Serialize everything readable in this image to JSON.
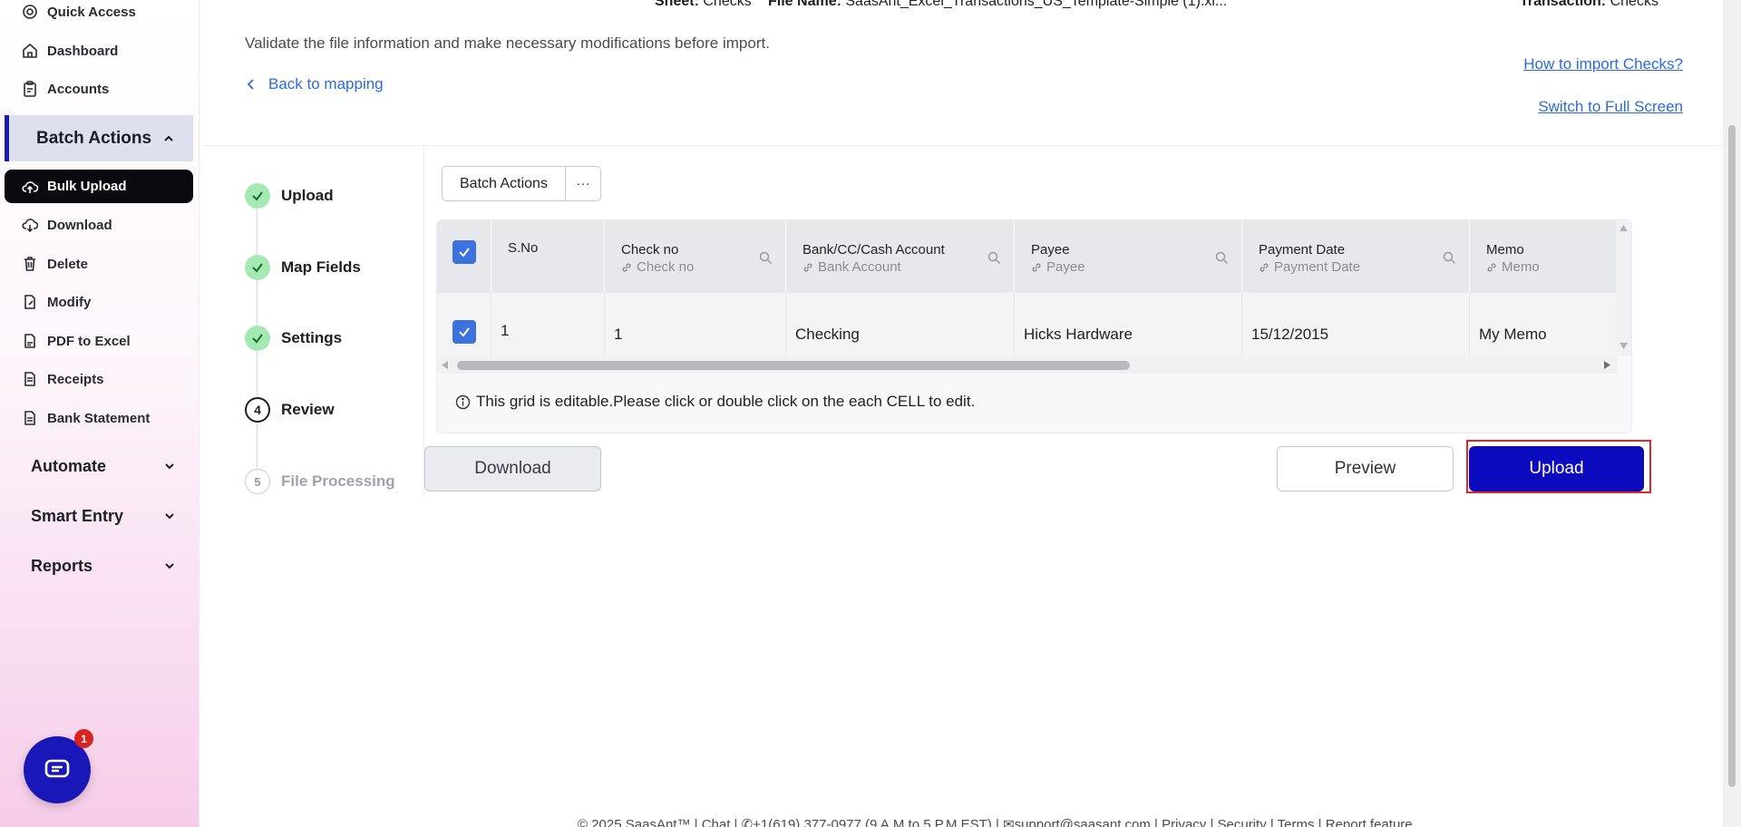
{
  "sidebar": {
    "links_top": [
      {
        "label": "Quick Access",
        "icon": "quick-access-icon"
      },
      {
        "label": "Dashboard",
        "icon": "home-icon"
      },
      {
        "label": "Accounts",
        "icon": "clipboard-icon"
      }
    ],
    "section_title": "Batch Actions",
    "active_item": "Bulk Upload",
    "items": [
      {
        "label": "Download",
        "icon": "cloud-download-icon"
      },
      {
        "label": "Delete",
        "icon": "trash-icon"
      },
      {
        "label": "Modify",
        "icon": "edit-file-icon"
      },
      {
        "label": "PDF to Excel",
        "icon": "pdf-icon"
      },
      {
        "label": "Receipts",
        "icon": "receipt-icon"
      },
      {
        "label": "Bank Statement",
        "icon": "statement-icon"
      }
    ],
    "groups": [
      "Automate",
      "Smart Entry",
      "Reports"
    ],
    "chat_badge": "1"
  },
  "header": {
    "sheet_label": "Sheet:",
    "sheet_value": "Checks",
    "file_label": "File Name:",
    "file_value": "SaasAnt_Excel_Transactions_US_Template-Simple (1).xl...",
    "transaction_label": "Transaction:",
    "transaction_value": "Checks",
    "subtitle": "Validate the file information and make necessary modifications before import.",
    "back_link": "Back to mapping",
    "help_link": "How to import Checks?",
    "fullscreen_link": "Switch to Full Screen"
  },
  "steps": [
    {
      "label": "Upload",
      "state": "done",
      "num": ""
    },
    {
      "label": "Map Fields",
      "state": "done",
      "num": ""
    },
    {
      "label": "Settings",
      "state": "done",
      "num": ""
    },
    {
      "label": "Review",
      "state": "current",
      "num": "4"
    },
    {
      "label": "File Processing",
      "state": "todo",
      "num": "5"
    }
  ],
  "toolbar": {
    "batch_actions": "Batch Actions",
    "more": "···"
  },
  "grid": {
    "columns": [
      {
        "title": "S.No",
        "sub": ""
      },
      {
        "title": "Check no",
        "sub": "Check no"
      },
      {
        "title": "Bank/CC/Cash Account",
        "sub": "Bank Account"
      },
      {
        "title": "Payee",
        "sub": "Payee"
      },
      {
        "title": "Payment Date",
        "sub": "Payment Date"
      },
      {
        "title": "Memo",
        "sub": "Memo"
      }
    ],
    "rows": [
      [
        "1",
        "1",
        "Checking",
        "Hicks Hardware",
        "15/12/2015",
        "My Memo"
      ]
    ],
    "note": "This grid is editable.Please click or double click on the each CELL to edit."
  },
  "actions": {
    "download": "Download",
    "preview": "Preview",
    "upload": "Upload"
  },
  "footer": "© 2025 SaasAnt™  |  Chat  |  ✆+1(619) 377-0977 (9 A.M to 5 P.M EST)  |  ✉support@saasant.com  |  Privacy  |  Security  |  Terms  |  Report feature",
  "colors": {
    "accent": "#0c0bbf",
    "link": "#2b6cd9",
    "done": "#a4e8b4",
    "highlight": "#e0252b"
  }
}
